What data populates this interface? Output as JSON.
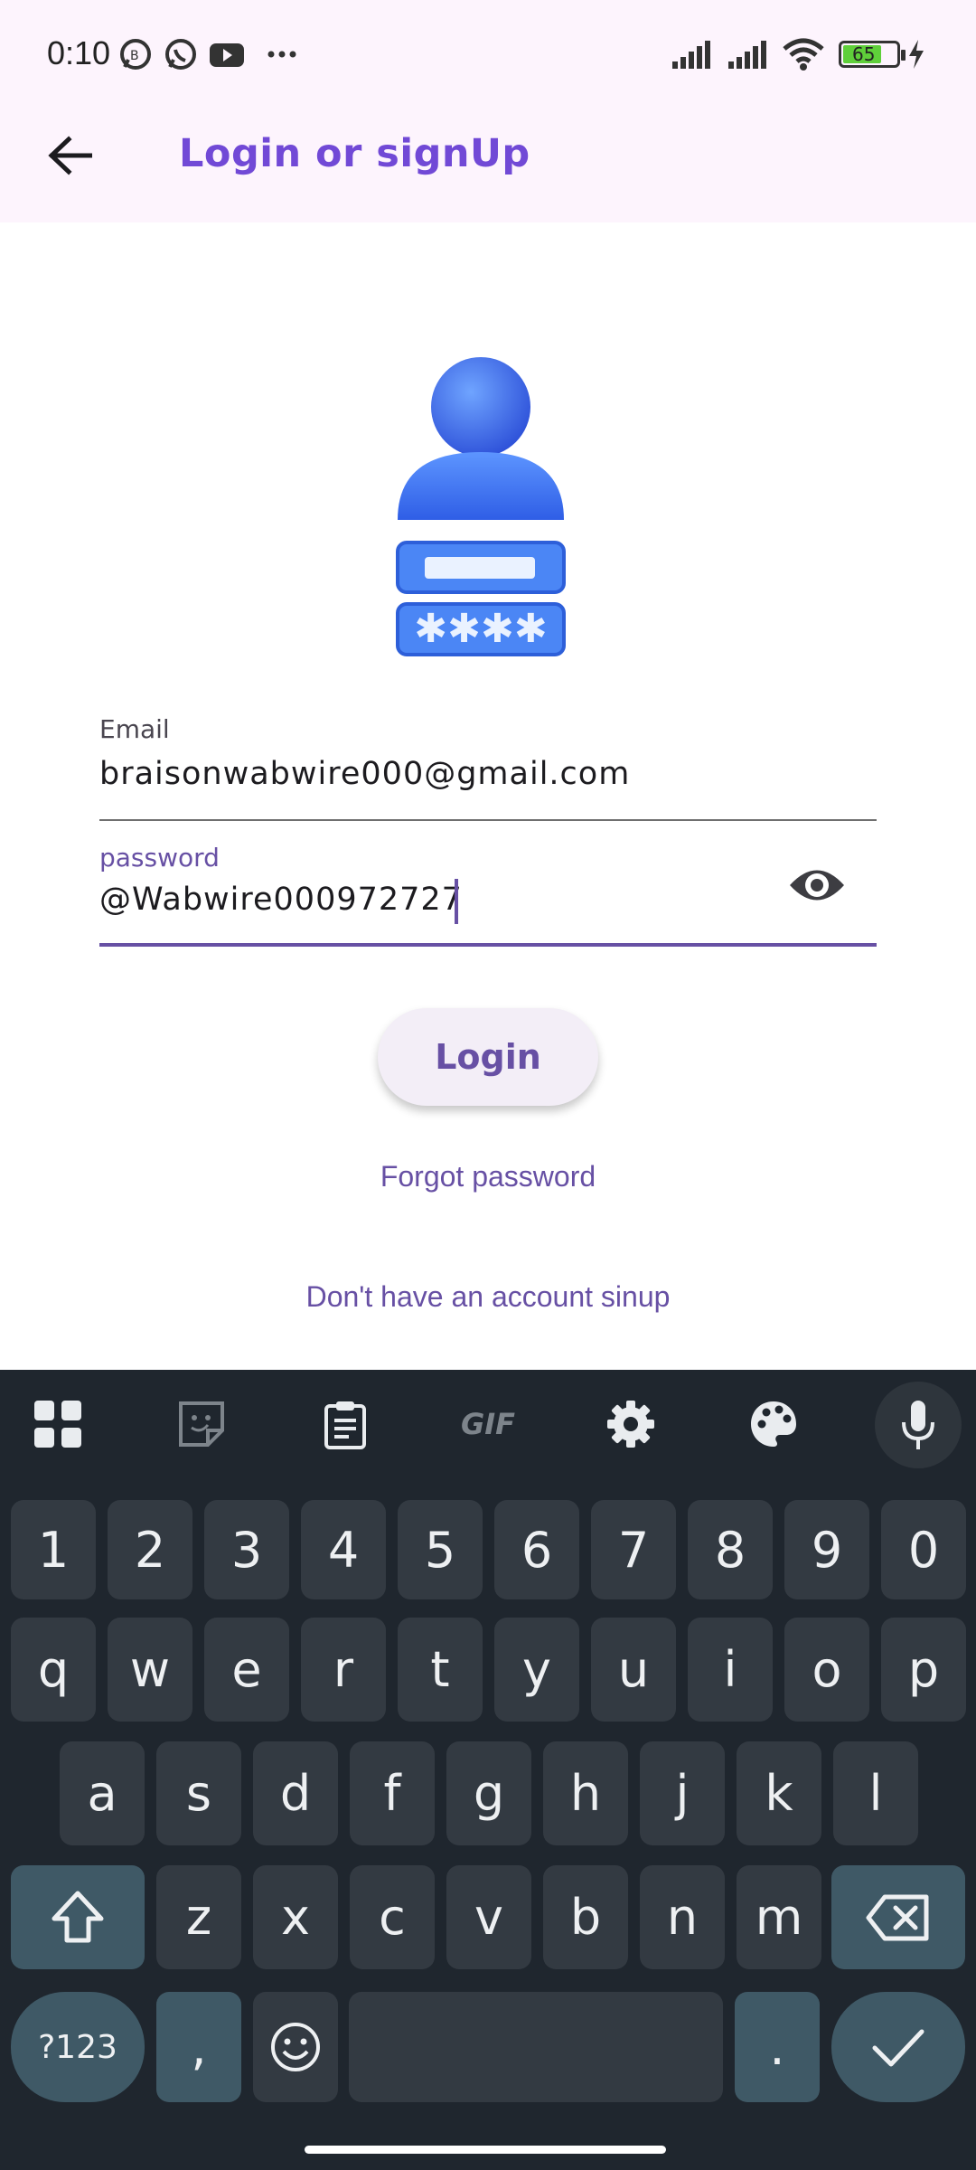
{
  "status_bar": {
    "time": "0:10",
    "battery": "65"
  },
  "app_bar": {
    "title": "Login or signUp"
  },
  "form": {
    "email_label": "Email",
    "email_value": "braisonwabwire000@gmail.com",
    "password_label": "password",
    "password_value": "@Wabwire000972727",
    "login_label": "Login",
    "forgot_label": "Forgot password",
    "signup_label": "Don't have an account sinup"
  },
  "keyboard": {
    "toolbar": [
      "apps-icon",
      "sticker-icon",
      "clipboard-icon",
      "gif-icon",
      "settings-icon",
      "palette-icon",
      "mic-icon"
    ],
    "gif_label": "GIF",
    "row_numbers": [
      "1",
      "2",
      "3",
      "4",
      "5",
      "6",
      "7",
      "8",
      "9",
      "0"
    ],
    "row1": [
      "q",
      "w",
      "e",
      "r",
      "t",
      "y",
      "u",
      "i",
      "o",
      "p"
    ],
    "row2": [
      "a",
      "s",
      "d",
      "f",
      "g",
      "h",
      "j",
      "k",
      "l"
    ],
    "row3": [
      "z",
      "x",
      "c",
      "v",
      "b",
      "n",
      "m"
    ],
    "symbols_label": "?123",
    "comma": ",",
    "period": "."
  },
  "colors": {
    "accent": "#6750a4",
    "title": "#7149d6",
    "appbar_bg": "#fdf4fd",
    "keyboard_bg": "#1f262e"
  }
}
